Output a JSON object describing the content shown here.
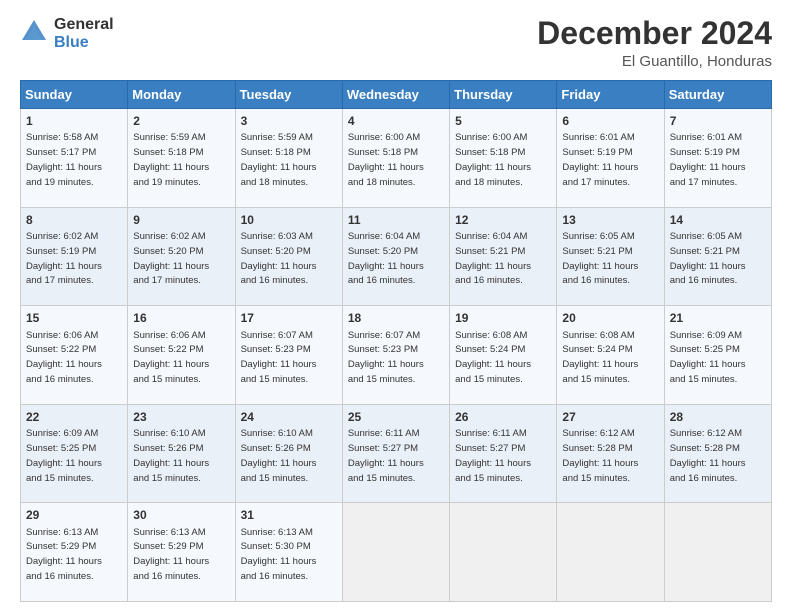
{
  "logo": {
    "general": "General",
    "blue": "Blue"
  },
  "title": "December 2024",
  "location": "El Guantillo, Honduras",
  "days_header": [
    "Sunday",
    "Monday",
    "Tuesday",
    "Wednesday",
    "Thursday",
    "Friday",
    "Saturday"
  ],
  "weeks": [
    [
      {
        "day": "1",
        "info": "Sunrise: 5:58 AM\nSunset: 5:17 PM\nDaylight: 11 hours\nand 19 minutes."
      },
      {
        "day": "2",
        "info": "Sunrise: 5:59 AM\nSunset: 5:18 PM\nDaylight: 11 hours\nand 19 minutes."
      },
      {
        "day": "3",
        "info": "Sunrise: 5:59 AM\nSunset: 5:18 PM\nDaylight: 11 hours\nand 18 minutes."
      },
      {
        "day": "4",
        "info": "Sunrise: 6:00 AM\nSunset: 5:18 PM\nDaylight: 11 hours\nand 18 minutes."
      },
      {
        "day": "5",
        "info": "Sunrise: 6:00 AM\nSunset: 5:18 PM\nDaylight: 11 hours\nand 18 minutes."
      },
      {
        "day": "6",
        "info": "Sunrise: 6:01 AM\nSunset: 5:19 PM\nDaylight: 11 hours\nand 17 minutes."
      },
      {
        "day": "7",
        "info": "Sunrise: 6:01 AM\nSunset: 5:19 PM\nDaylight: 11 hours\nand 17 minutes."
      }
    ],
    [
      {
        "day": "8",
        "info": "Sunrise: 6:02 AM\nSunset: 5:19 PM\nDaylight: 11 hours\nand 17 minutes."
      },
      {
        "day": "9",
        "info": "Sunrise: 6:02 AM\nSunset: 5:20 PM\nDaylight: 11 hours\nand 17 minutes."
      },
      {
        "day": "10",
        "info": "Sunrise: 6:03 AM\nSunset: 5:20 PM\nDaylight: 11 hours\nand 16 minutes."
      },
      {
        "day": "11",
        "info": "Sunrise: 6:04 AM\nSunset: 5:20 PM\nDaylight: 11 hours\nand 16 minutes."
      },
      {
        "day": "12",
        "info": "Sunrise: 6:04 AM\nSunset: 5:21 PM\nDaylight: 11 hours\nand 16 minutes."
      },
      {
        "day": "13",
        "info": "Sunrise: 6:05 AM\nSunset: 5:21 PM\nDaylight: 11 hours\nand 16 minutes."
      },
      {
        "day": "14",
        "info": "Sunrise: 6:05 AM\nSunset: 5:21 PM\nDaylight: 11 hours\nand 16 minutes."
      }
    ],
    [
      {
        "day": "15",
        "info": "Sunrise: 6:06 AM\nSunset: 5:22 PM\nDaylight: 11 hours\nand 16 minutes."
      },
      {
        "day": "16",
        "info": "Sunrise: 6:06 AM\nSunset: 5:22 PM\nDaylight: 11 hours\nand 15 minutes."
      },
      {
        "day": "17",
        "info": "Sunrise: 6:07 AM\nSunset: 5:23 PM\nDaylight: 11 hours\nand 15 minutes."
      },
      {
        "day": "18",
        "info": "Sunrise: 6:07 AM\nSunset: 5:23 PM\nDaylight: 11 hours\nand 15 minutes."
      },
      {
        "day": "19",
        "info": "Sunrise: 6:08 AM\nSunset: 5:24 PM\nDaylight: 11 hours\nand 15 minutes."
      },
      {
        "day": "20",
        "info": "Sunrise: 6:08 AM\nSunset: 5:24 PM\nDaylight: 11 hours\nand 15 minutes."
      },
      {
        "day": "21",
        "info": "Sunrise: 6:09 AM\nSunset: 5:25 PM\nDaylight: 11 hours\nand 15 minutes."
      }
    ],
    [
      {
        "day": "22",
        "info": "Sunrise: 6:09 AM\nSunset: 5:25 PM\nDaylight: 11 hours\nand 15 minutes."
      },
      {
        "day": "23",
        "info": "Sunrise: 6:10 AM\nSunset: 5:26 PM\nDaylight: 11 hours\nand 15 minutes."
      },
      {
        "day": "24",
        "info": "Sunrise: 6:10 AM\nSunset: 5:26 PM\nDaylight: 11 hours\nand 15 minutes."
      },
      {
        "day": "25",
        "info": "Sunrise: 6:11 AM\nSunset: 5:27 PM\nDaylight: 11 hours\nand 15 minutes."
      },
      {
        "day": "26",
        "info": "Sunrise: 6:11 AM\nSunset: 5:27 PM\nDaylight: 11 hours\nand 15 minutes."
      },
      {
        "day": "27",
        "info": "Sunrise: 6:12 AM\nSunset: 5:28 PM\nDaylight: 11 hours\nand 15 minutes."
      },
      {
        "day": "28",
        "info": "Sunrise: 6:12 AM\nSunset: 5:28 PM\nDaylight: 11 hours\nand 16 minutes."
      }
    ],
    [
      {
        "day": "29",
        "info": "Sunrise: 6:13 AM\nSunset: 5:29 PM\nDaylight: 11 hours\nand 16 minutes."
      },
      {
        "day": "30",
        "info": "Sunrise: 6:13 AM\nSunset: 5:29 PM\nDaylight: 11 hours\nand 16 minutes."
      },
      {
        "day": "31",
        "info": "Sunrise: 6:13 AM\nSunset: 5:30 PM\nDaylight: 11 hours\nand 16 minutes."
      },
      {
        "day": "",
        "info": ""
      },
      {
        "day": "",
        "info": ""
      },
      {
        "day": "",
        "info": ""
      },
      {
        "day": "",
        "info": ""
      }
    ]
  ]
}
